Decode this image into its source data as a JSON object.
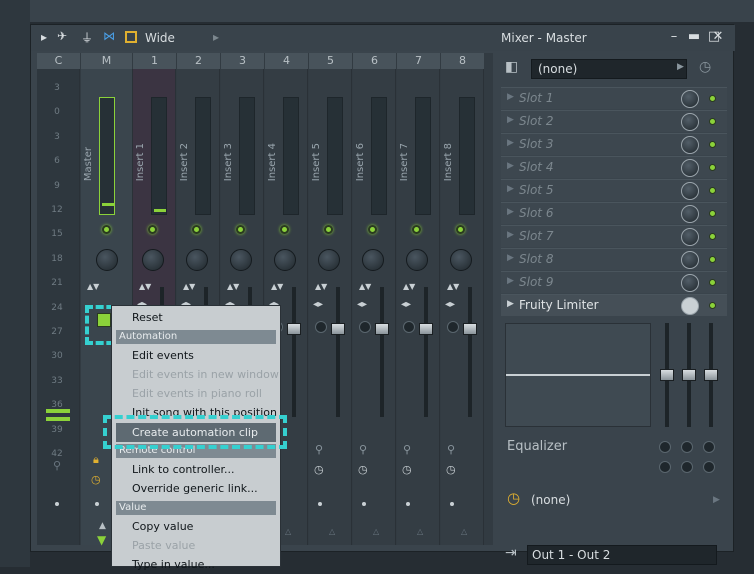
{
  "toolbar": {
    "mode_label": "Wide",
    "window_title": "Mixer - Master"
  },
  "strips": {
    "headers": [
      "C",
      "M",
      "1",
      "2",
      "3",
      "4",
      "5",
      "6",
      "7",
      "8"
    ],
    "master_label": "Master",
    "insert_labels": [
      "Insert 1",
      "Insert 2",
      "Insert 3",
      "Insert 4",
      "Insert 5",
      "Insert 6",
      "Insert 7",
      "Insert 8"
    ],
    "scale": [
      "3",
      "0",
      "3",
      "6",
      "9",
      "12",
      "15",
      "18",
      "21",
      "24",
      "27",
      "30",
      "33",
      "36",
      "39",
      "42"
    ]
  },
  "right_panel": {
    "preset": "(none)",
    "slots": [
      "Slot 1",
      "Slot 2",
      "Slot 3",
      "Slot 4",
      "Slot 5",
      "Slot 6",
      "Slot 7",
      "Slot 8",
      "Slot 9"
    ],
    "active_plugin": "Fruity Limiter",
    "eq_label": "Equalizer",
    "route": "(none)",
    "output": "Out 1 - Out 2"
  },
  "menu": {
    "items": [
      {
        "type": "item",
        "label": "Reset"
      },
      {
        "type": "sep",
        "label": "Automation"
      },
      {
        "type": "item",
        "label": "Edit events"
      },
      {
        "type": "dis",
        "label": "Edit events in new window"
      },
      {
        "type": "dis",
        "label": "Edit events in piano roll"
      },
      {
        "type": "item",
        "label": "Init song with this position"
      },
      {
        "type": "item",
        "label": "Create automation clip"
      },
      {
        "type": "sep",
        "label": "Remote control"
      },
      {
        "type": "item",
        "label": "Link to controller..."
      },
      {
        "type": "item",
        "label": "Override generic link..."
      },
      {
        "type": "sep",
        "label": "Value"
      },
      {
        "type": "item",
        "label": "Copy value"
      },
      {
        "type": "dis",
        "label": "Paste value"
      },
      {
        "type": "item",
        "label": "Type in value..."
      }
    ]
  },
  "colors": {
    "accent_green": "#8bd23a",
    "highlight": "#35d0d0"
  }
}
